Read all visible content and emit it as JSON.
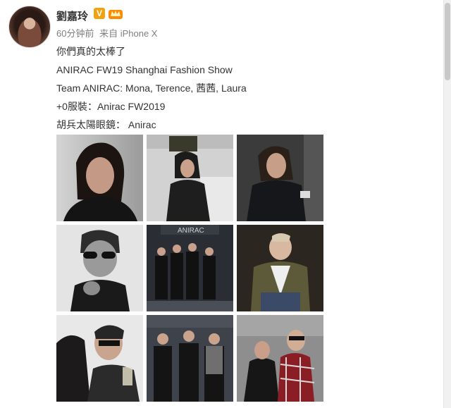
{
  "post": {
    "author": "劉嘉玲",
    "verified_badge": "V",
    "time": "60分钟前",
    "source": "来自 iPhone X",
    "lines": [
      "你們真的太棒了",
      "ANIRAC FW19 Shanghai Fashion Show",
      "Team ANIRAC: Mona, Terence, 茜茜, Laura",
      "+0服裝：Anirac FW2019",
      "胡兵太陽眼鏡： Anirac"
    ]
  },
  "photos": [
    {
      "name": "photo-portrait-woman",
      "bg": "#b9b9b9"
    },
    {
      "name": "photo-woman-seated",
      "bg": "#c8c8c8"
    },
    {
      "name": "photo-woman-show",
      "bg": "#3c3c3c"
    },
    {
      "name": "photo-man-sunglasses",
      "bg": "#e0e0e0"
    },
    {
      "name": "photo-group-stage",
      "bg": "#26282c"
    },
    {
      "name": "photo-man-jacket",
      "bg": "#2f2a24"
    },
    {
      "name": "photo-kiss",
      "bg": "#e5e5e5"
    },
    {
      "name": "photo-group-three",
      "bg": "#3b3f46"
    },
    {
      "name": "photo-couple",
      "bg": "#8b8b8b"
    }
  ],
  "colors": {
    "badge": "#f2a20f",
    "meta": "#808080",
    "text": "#333333"
  }
}
